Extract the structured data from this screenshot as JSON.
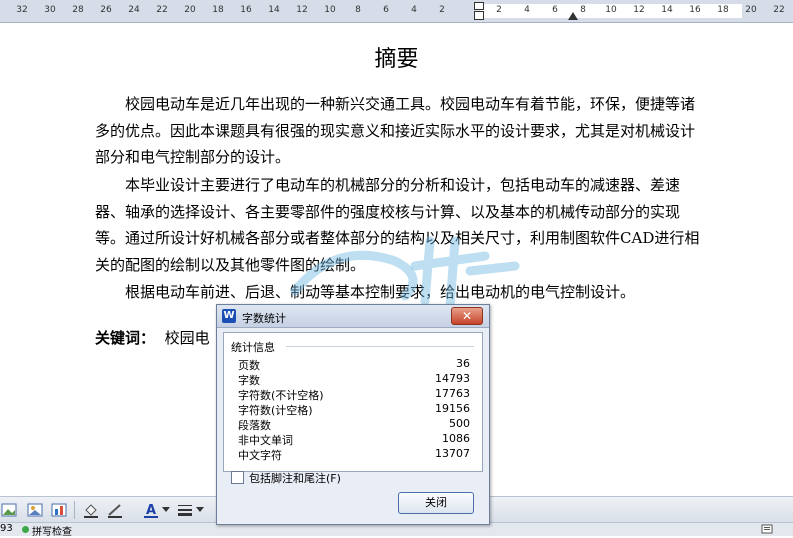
{
  "ruler": {
    "left_ticks": [
      "32",
      "30",
      "28",
      "26",
      "24",
      "22",
      "20",
      "18",
      "16",
      "14",
      "12",
      "10",
      "8",
      "6",
      "4",
      "2"
    ],
    "right_ticks": [
      "2",
      "4",
      "6",
      "8",
      "10",
      "12",
      "14",
      "16",
      "18",
      "20",
      "22"
    ]
  },
  "document": {
    "title": "摘要",
    "paragraphs": [
      "　　校园电动车是近几年出现的一种新兴交通工具。校园电动车有着节能，环保，便捷等诸多的优点。因此本课题具有很强的现实意义和接近实际水平的设计要求，尤其是对机械设计部分和电气控制部分的设计。",
      "　　本毕业设计主要进行了电动车的机械部分的分析和设计，包括电动车的减速器、差速器、轴承的选择设计、各主要零部件的强度校核与计算、以及基本的机械传动部分的实现等。通过所设计好机械各部分或者整体部分的结构以及相关尺寸，利用制图软件CAD进行相关的配图的绘制以及其他零件图的绘制。",
      "　　根据电动车前进、后退、制动等基本控制要求，给出电动机的电气控制设计。"
    ],
    "keywords_label": "关键词：",
    "keywords_value": "校园电"
  },
  "dialog": {
    "logo": "W",
    "title": "字数统计",
    "close_symbol": "✕",
    "section_label": "统计信息",
    "stats": [
      {
        "label": "页数",
        "value": "36"
      },
      {
        "label": "字数",
        "value": "14793"
      },
      {
        "label": "字符数(不计空格)",
        "value": "17763"
      },
      {
        "label": "字符数(计空格)",
        "value": "19156"
      },
      {
        "label": "段落数",
        "value": "500"
      },
      {
        "label": "非中文单词",
        "value": "1086"
      },
      {
        "label": "中文字符",
        "value": "13707"
      }
    ],
    "checkbox_label": "包括脚注和尾注(F)",
    "close_button": "关闭"
  },
  "statusbar": {
    "page_fragment": "93",
    "spell_check": "拼写检查"
  },
  "colors": {
    "ruler_bg": "#d6dde8",
    "dialog_bg": "#e9edf5",
    "close_red": "#c6432a",
    "button_border": "#4a6ea8",
    "status_green": "#3aa844"
  }
}
